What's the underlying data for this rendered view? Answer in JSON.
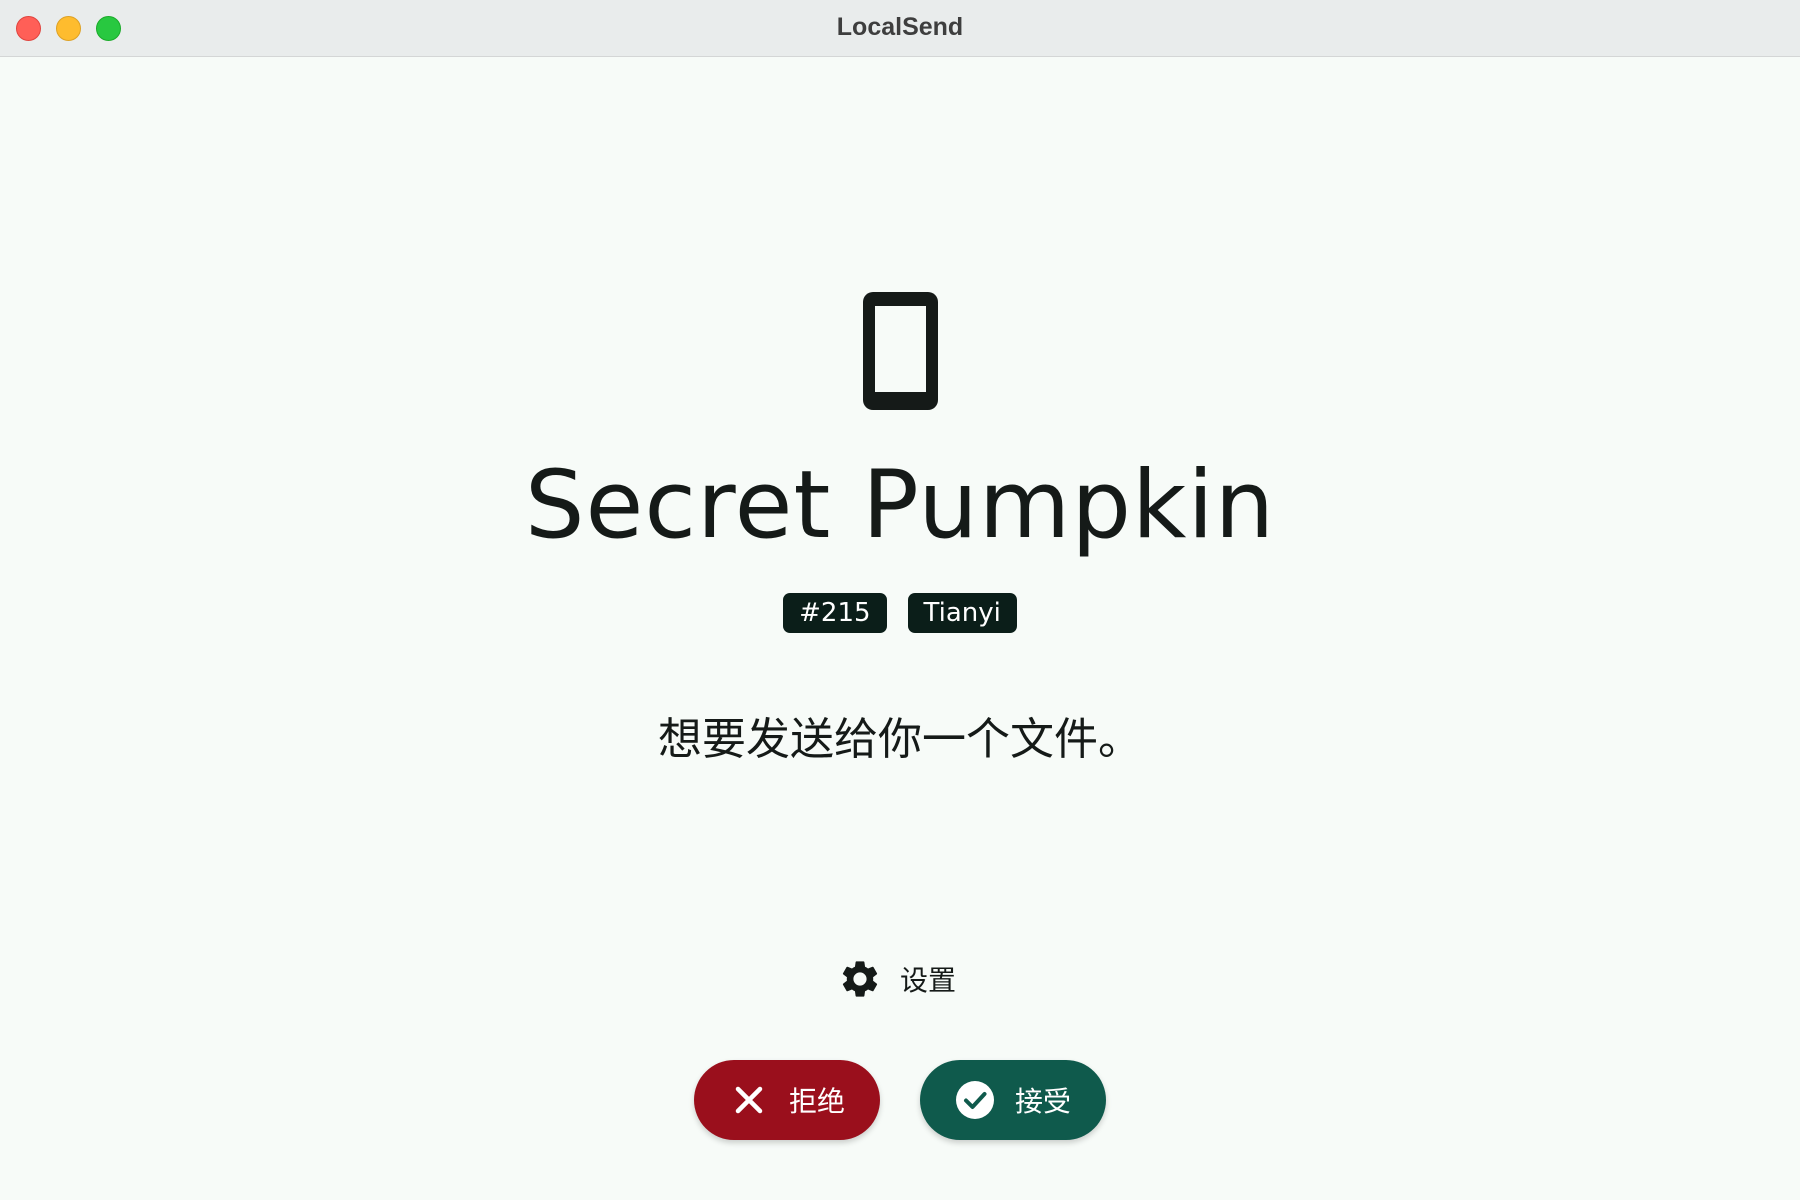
{
  "window": {
    "title": "LocalSend",
    "traffic_lights": [
      "close",
      "minimize",
      "maximize"
    ]
  },
  "sender": {
    "device_icon": "smartphone-icon",
    "device_name": "Secret Pumpkin",
    "badges": [
      "#215",
      "Tianyi"
    ]
  },
  "message": "想要发送给你一个文件。",
  "settings": {
    "icon": "gear-icon",
    "label": "设置"
  },
  "actions": {
    "decline": {
      "label": "拒绝",
      "icon": "close-icon",
      "color": "#9a0f1c"
    },
    "accept": {
      "label": "接受",
      "icon": "check-circle-icon",
      "color": "#0f5a4c"
    }
  },
  "colors": {
    "background": "#f7fbf8",
    "text": "#151a18",
    "badge_bg": "#0b1e19"
  }
}
